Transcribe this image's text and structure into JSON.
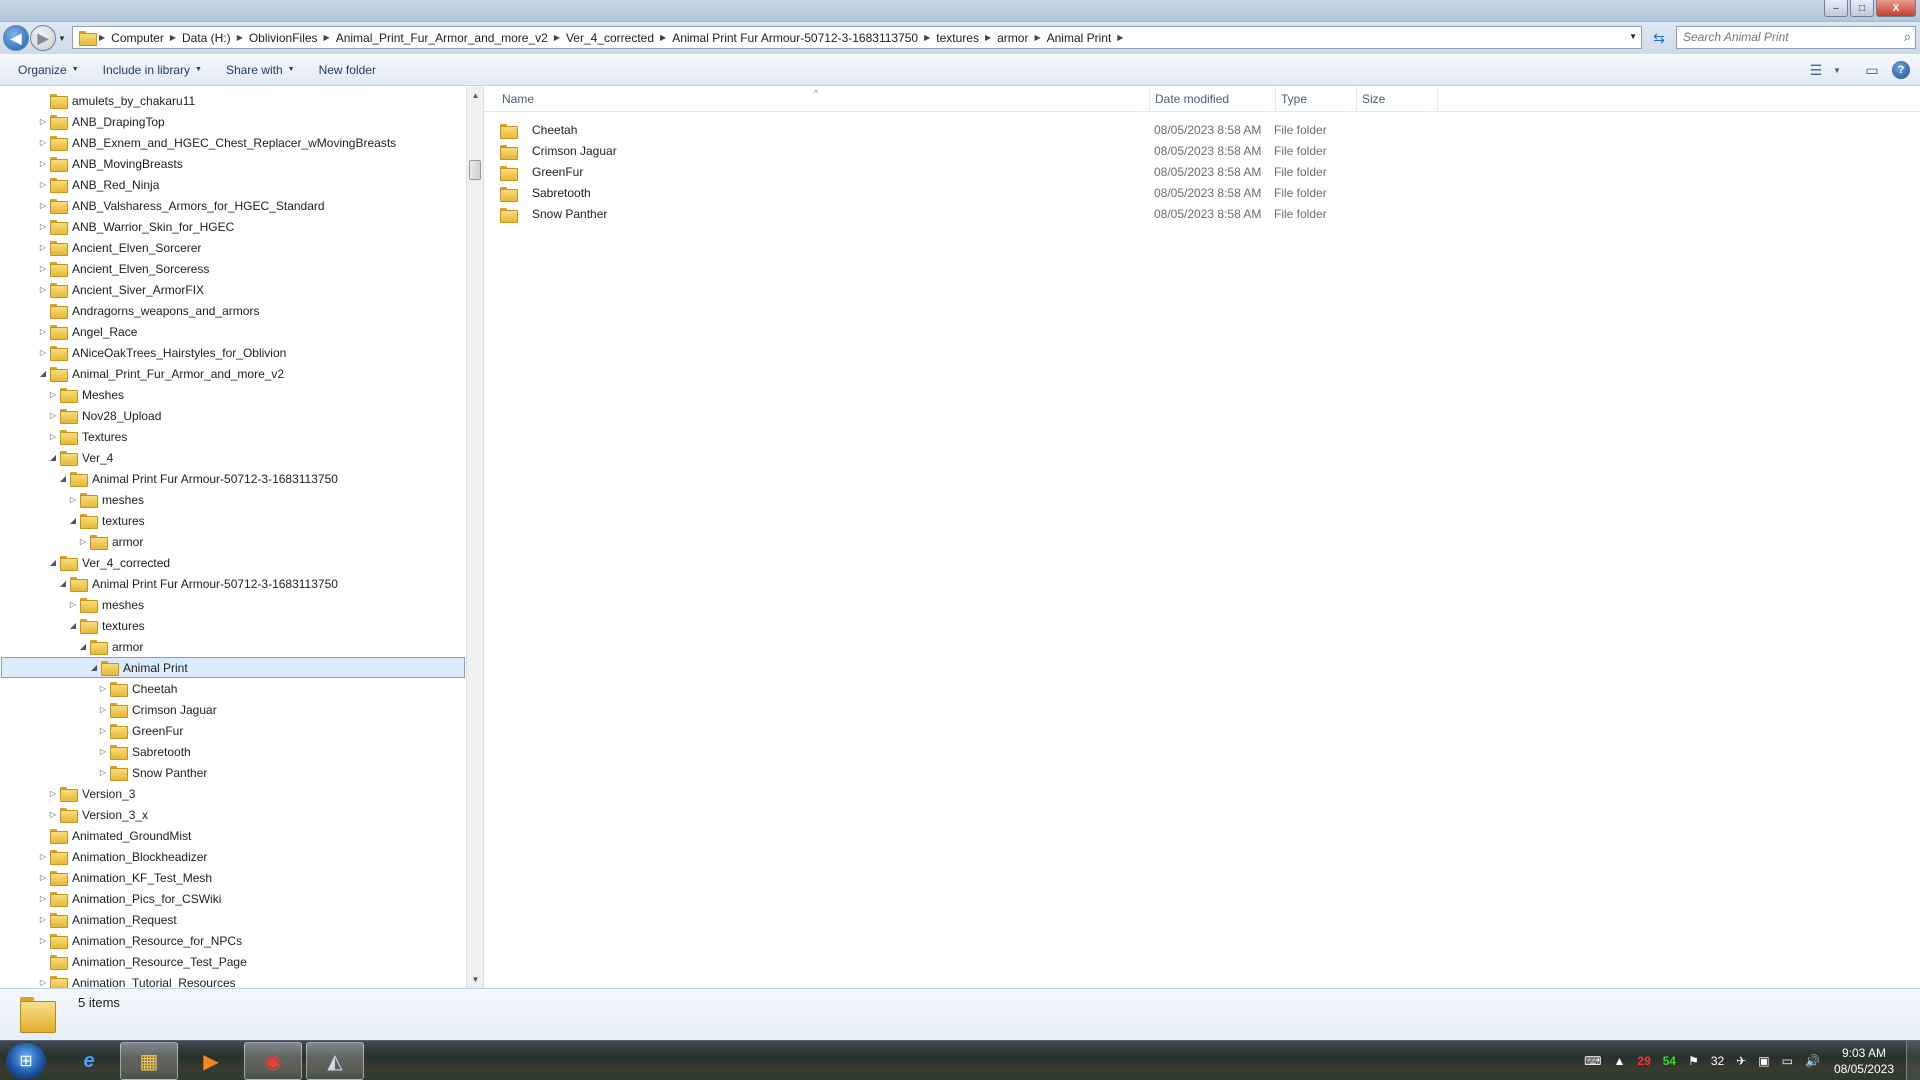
{
  "window": {
    "title": "",
    "buttons": {
      "minimize": "–",
      "maximize": "□",
      "close": "X"
    }
  },
  "address": {
    "crumbs": [
      "Computer",
      "Data (H:)",
      "OblivionFiles",
      "Animal_Print_Fur_Armor_and_more_v2",
      "Ver_4_corrected",
      "Animal Print Fur Armour-50712-3-1683113750",
      "textures",
      "armor",
      "Animal Print"
    ],
    "search_placeholder": "Search Animal Print"
  },
  "toolbar": {
    "organize": "Organize",
    "include_in_library": "Include in library",
    "share_with": "Share with",
    "new_folder": "New folder"
  },
  "tree": [
    {
      "label": "amulets_by_chakaru11",
      "depth": 0,
      "state": "none"
    },
    {
      "label": "ANB_DrapingTop",
      "depth": 0,
      "state": "collapsed"
    },
    {
      "label": "ANB_Exnem_and_HGEC_Chest_Replacer_wMovingBreasts",
      "depth": 0,
      "state": "collapsed"
    },
    {
      "label": "ANB_MovingBreasts",
      "depth": 0,
      "state": "collapsed"
    },
    {
      "label": "ANB_Red_Ninja",
      "depth": 0,
      "state": "collapsed"
    },
    {
      "label": "ANB_Valsharess_Armors_for_HGEC_Standard",
      "depth": 0,
      "state": "collapsed"
    },
    {
      "label": "ANB_Warrior_Skin_for_HGEC",
      "depth": 0,
      "state": "collapsed"
    },
    {
      "label": "Ancient_Elven_Sorcerer",
      "depth": 0,
      "state": "collapsed"
    },
    {
      "label": "Ancient_Elven_Sorceress",
      "depth": 0,
      "state": "collapsed"
    },
    {
      "label": "Ancient_Siver_ArmorFIX",
      "depth": 0,
      "state": "collapsed"
    },
    {
      "label": "Andragorns_weapons_and_armors",
      "depth": 0,
      "state": "none"
    },
    {
      "label": "Angel_Race",
      "depth": 0,
      "state": "collapsed"
    },
    {
      "label": "ANiceOakTrees_Hairstyles_for_Oblivion",
      "depth": 0,
      "state": "collapsed"
    },
    {
      "label": "Animal_Print_Fur_Armor_and_more_v2",
      "depth": 0,
      "state": "expanded"
    },
    {
      "label": "Meshes",
      "depth": 1,
      "state": "collapsed"
    },
    {
      "label": "Nov28_Upload",
      "depth": 1,
      "state": "collapsed"
    },
    {
      "label": "Textures",
      "depth": 1,
      "state": "collapsed"
    },
    {
      "label": "Ver_4",
      "depth": 1,
      "state": "expanded"
    },
    {
      "label": "Animal Print Fur Armour-50712-3-1683113750",
      "depth": 2,
      "state": "expanded"
    },
    {
      "label": "meshes",
      "depth": 3,
      "state": "collapsed"
    },
    {
      "label": "textures",
      "depth": 3,
      "state": "expanded"
    },
    {
      "label": "armor",
      "depth": 4,
      "state": "collapsed"
    },
    {
      "label": "Ver_4_corrected",
      "depth": 1,
      "state": "expanded"
    },
    {
      "label": "Animal Print Fur Armour-50712-3-1683113750",
      "depth": 2,
      "state": "expanded"
    },
    {
      "label": "meshes",
      "depth": 3,
      "state": "collapsed"
    },
    {
      "label": "textures",
      "depth": 3,
      "state": "expanded"
    },
    {
      "label": "armor",
      "depth": 4,
      "state": "expanded"
    },
    {
      "label": "Animal Print",
      "depth": 5,
      "state": "expanded",
      "selected": true
    },
    {
      "label": "Cheetah",
      "depth": 6,
      "state": "collapsed"
    },
    {
      "label": "Crimson Jaguar",
      "depth": 6,
      "state": "collapsed"
    },
    {
      "label": "GreenFur",
      "depth": 6,
      "state": "collapsed"
    },
    {
      "label": "Sabretooth",
      "depth": 6,
      "state": "collapsed"
    },
    {
      "label": "Snow Panther",
      "depth": 6,
      "state": "collapsed"
    },
    {
      "label": "Version_3",
      "depth": 1,
      "state": "collapsed"
    },
    {
      "label": "Version_3_x",
      "depth": 1,
      "state": "collapsed"
    },
    {
      "label": "Animated_GroundMist",
      "depth": 0,
      "state": "none"
    },
    {
      "label": "Animation_Blockheadizer",
      "depth": 0,
      "state": "collapsed"
    },
    {
      "label": "Animation_KF_Test_Mesh",
      "depth": 0,
      "state": "collapsed"
    },
    {
      "label": "Animation_Pics_for_CSWiki",
      "depth": 0,
      "state": "collapsed"
    },
    {
      "label": "Animation_Request",
      "depth": 0,
      "state": "collapsed"
    },
    {
      "label": "Animation_Resource_for_NPCs",
      "depth": 0,
      "state": "collapsed"
    },
    {
      "label": "Animation_Resource_Test_Page",
      "depth": 0,
      "state": "none"
    },
    {
      "label": "Animation_Tutorial_Resources",
      "depth": 0,
      "state": "collapsed"
    }
  ],
  "columns": {
    "name": "Name",
    "date": "Date modified",
    "type": "Type",
    "size": "Size"
  },
  "files": [
    {
      "name": "Cheetah",
      "date": "08/05/2023 8:58 AM",
      "type": "File folder"
    },
    {
      "name": "Crimson Jaguar",
      "date": "08/05/2023 8:58 AM",
      "type": "File folder"
    },
    {
      "name": "GreenFur",
      "date": "08/05/2023 8:58 AM",
      "type": "File folder"
    },
    {
      "name": "Sabretooth",
      "date": "08/05/2023 8:58 AM",
      "type": "File folder"
    },
    {
      "name": "Snow Panther",
      "date": "08/05/2023 8:58 AM",
      "type": "File folder"
    }
  ],
  "status": {
    "item_count": "5 items"
  },
  "taskbar": {
    "apps": [
      "internet-explorer-icon",
      "windows-explorer-icon",
      "media-player-icon",
      "chrome-icon",
      "blender-icon"
    ],
    "tray": {
      "num_a": "29",
      "num_b": "54",
      "num_c": "32"
    },
    "clock": {
      "time": "9:03 AM",
      "date": "08/05/2023"
    }
  },
  "colors": {
    "selection": "#dcebfc",
    "folder": "#e8b83a",
    "accent": "#1b5fb4"
  }
}
